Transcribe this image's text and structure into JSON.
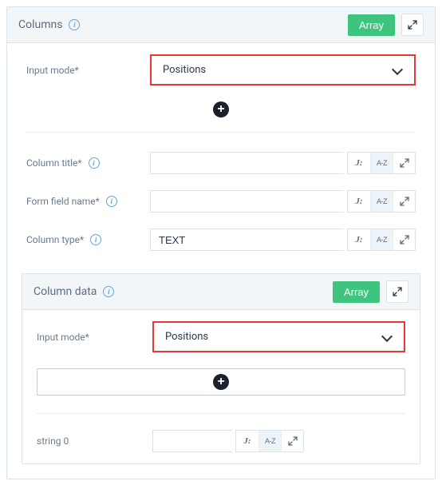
{
  "columns_panel": {
    "title": "Columns",
    "array_btn": "Array"
  },
  "input_mode": {
    "label": "Input mode*",
    "value": "Positions"
  },
  "column_title": {
    "label": "Column title*",
    "value": ""
  },
  "form_field_name": {
    "label": "Form field name*",
    "value": ""
  },
  "column_type": {
    "label": "Column type*",
    "value": "TEXT"
  },
  "column_data_panel": {
    "title": "Column data",
    "array_btn": "Array"
  },
  "nested_input_mode": {
    "label": "Input mode*",
    "value": "Positions"
  },
  "string0": {
    "label": "string 0",
    "value": ""
  },
  "addons": {
    "j": "J:",
    "az": "A-Z"
  }
}
